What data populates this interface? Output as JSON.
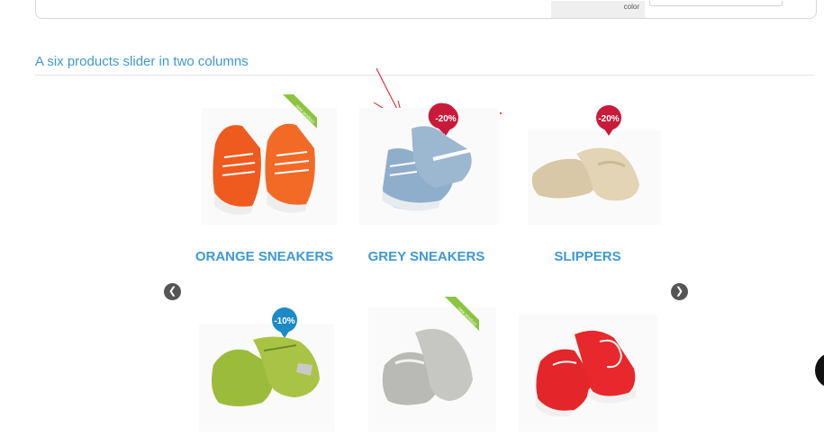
{
  "filter_panel": {
    "color_label": "color"
  },
  "section": {
    "title": "A six products slider in two columns"
  },
  "slider": {
    "prev_icon": "chevron-left-icon",
    "next_icon": "chevron-right-icon",
    "products": [
      {
        "name": "ORANGE SNEAKERS",
        "tag": "new product",
        "color": "#ef5a1f"
      },
      {
        "name": "GREY SNEAKERS",
        "badge": "-20%",
        "color": "#8faecb"
      },
      {
        "name": "SLIPPERS",
        "badge": "-20%",
        "color": "#d8c8a8"
      },
      {
        "badge": "-10%",
        "color": "#9bbb3a"
      },
      {
        "tag": "new product",
        "color": "#b9b9b6"
      },
      {
        "color": "#e3262a"
      }
    ]
  },
  "colors": {
    "accent": "#3e98d5",
    "sale_badge": "#c91a3a",
    "discount_badge_blue": "#1b8ac6",
    "new_ribbon": "#8cc43f"
  }
}
